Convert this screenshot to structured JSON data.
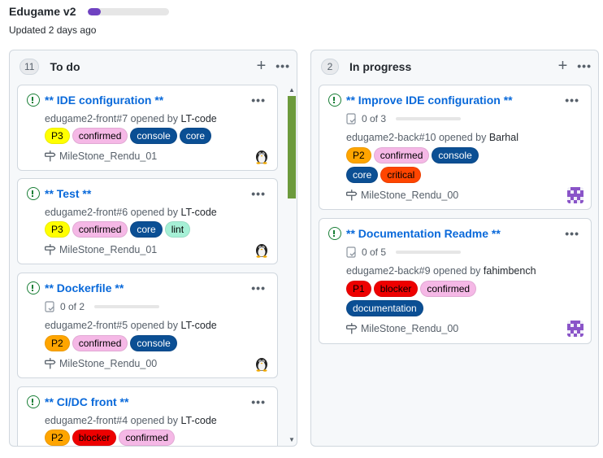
{
  "project": {
    "title": "Edugame v2",
    "updated": "Updated 2 days ago",
    "progress_fraction": 0.16,
    "progress_color": "#6f42c1"
  },
  "columns": [
    {
      "count": "11",
      "name": "To do",
      "cards": [
        {
          "title": "** IDE configuration **",
          "meta_prefix": "edugame2-front#7 opened by ",
          "user": "LT-code",
          "labels": [
            {
              "text": "P3",
              "bg": "#ffff00",
              "fg": "#000000"
            },
            {
              "text": "confirmed",
              "bg": "#f5b8e6",
              "fg": "#000000"
            },
            {
              "text": "console",
              "bg": "#0b4f94",
              "fg": "#ffffff"
            },
            {
              "text": "core",
              "bg": "#0b4f94",
              "fg": "#ffffff"
            }
          ],
          "milestone": "MileStone_Rendu_01",
          "avatar": "penguin-avatar"
        },
        {
          "title": "** Test **",
          "meta_prefix": "edugame2-front#6 opened by ",
          "user": "LT-code",
          "labels": [
            {
              "text": "P3",
              "bg": "#ffff00",
              "fg": "#000000"
            },
            {
              "text": "confirmed",
              "bg": "#f5b8e6",
              "fg": "#000000"
            },
            {
              "text": "core",
              "bg": "#0b4f94",
              "fg": "#ffffff"
            },
            {
              "text": "lint",
              "bg": "#a6f0d6",
              "fg": "#000000"
            }
          ],
          "milestone": "MileStone_Rendu_01",
          "avatar": "penguin-avatar"
        },
        {
          "title": "** Dockerfile **",
          "tasks": "0 of 2",
          "meta_prefix": "edugame2-front#5 opened by ",
          "user": "LT-code",
          "labels": [
            {
              "text": "P2",
              "bg": "#ffa500",
              "fg": "#000000"
            },
            {
              "text": "confirmed",
              "bg": "#f5b8e6",
              "fg": "#000000"
            },
            {
              "text": "console",
              "bg": "#0b4f94",
              "fg": "#ffffff"
            }
          ],
          "milestone": "MileStone_Rendu_00",
          "avatar": "penguin-avatar"
        },
        {
          "title": "** CI/DC front **",
          "meta_prefix": "edugame2-front#4 opened by ",
          "user": "LT-code",
          "labels": [
            {
              "text": "P2",
              "bg": "#ffa500",
              "fg": "#000000"
            },
            {
              "text": "blocker",
              "bg": "#ee0000",
              "fg": "#000000"
            },
            {
              "text": "confirmed",
              "bg": "#f5b8e6",
              "fg": "#000000"
            }
          ]
        }
      ]
    },
    {
      "count": "2",
      "name": "In progress",
      "cards": [
        {
          "title": "** Improve IDE configuration **",
          "tasks": "0 of 3",
          "meta_prefix": "edugame2-back#10 opened by ",
          "user": "Barhal",
          "labels": [
            {
              "text": "P2",
              "bg": "#ffa500",
              "fg": "#000000"
            },
            {
              "text": "confirmed",
              "bg": "#f5b8e6",
              "fg": "#000000"
            },
            {
              "text": "console",
              "bg": "#0b4f94",
              "fg": "#ffffff"
            },
            {
              "text": "core",
              "bg": "#0b4f94",
              "fg": "#ffffff"
            },
            {
              "text": "critical",
              "bg": "#ff4500",
              "fg": "#000000"
            }
          ],
          "milestone": "MileStone_Rendu_00",
          "avatar": "pixel-avatar"
        },
        {
          "title": "** Documentation Readme **",
          "tasks": "0 of 5",
          "meta_prefix": "edugame2-back#9 opened by ",
          "user": "fahimbench",
          "labels": [
            {
              "text": "P1",
              "bg": "#ee0000",
              "fg": "#000000"
            },
            {
              "text": "blocker",
              "bg": "#ee0000",
              "fg": "#000000"
            },
            {
              "text": "confirmed",
              "bg": "#f5b8e6",
              "fg": "#000000"
            },
            {
              "text": "documentation",
              "bg": "#0b4f94",
              "fg": "#ffffff"
            }
          ],
          "milestone": "MileStone_Rendu_00",
          "avatar": "pixel-avatar"
        }
      ]
    }
  ]
}
